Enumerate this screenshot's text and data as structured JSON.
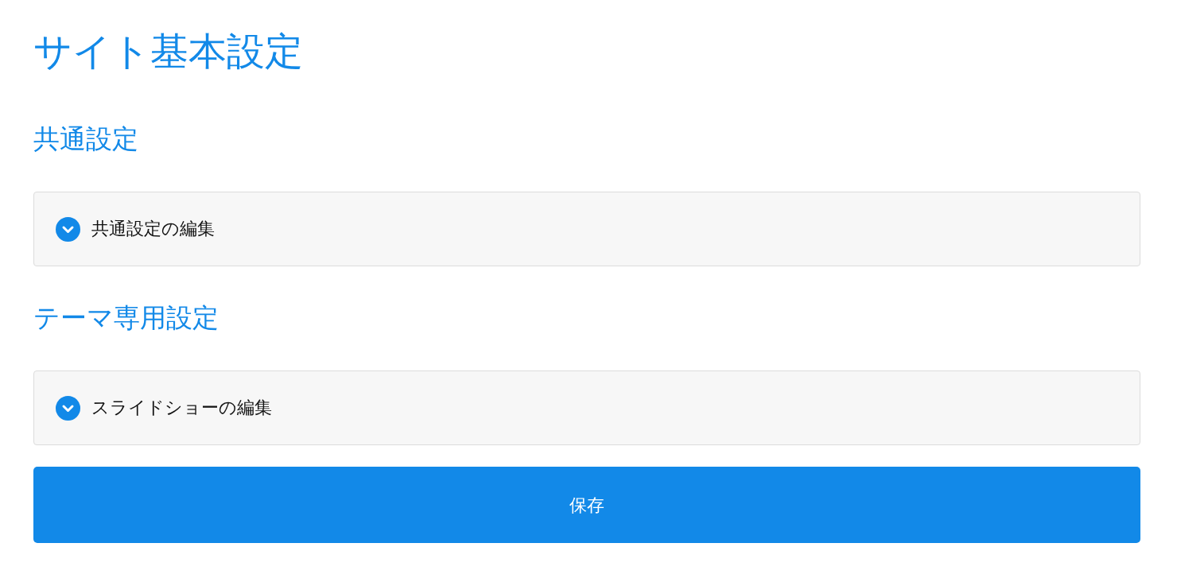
{
  "page": {
    "title": "サイト基本設定"
  },
  "sections": [
    {
      "heading": "共通設定",
      "panels": [
        {
          "label": "共通設定の編集",
          "expanded": false
        }
      ]
    },
    {
      "heading": "テーマ専用設定",
      "panels": [
        {
          "label": "スライドショーの編集",
          "expanded": false
        }
      ]
    }
  ],
  "save_button": {
    "label": "保存"
  }
}
